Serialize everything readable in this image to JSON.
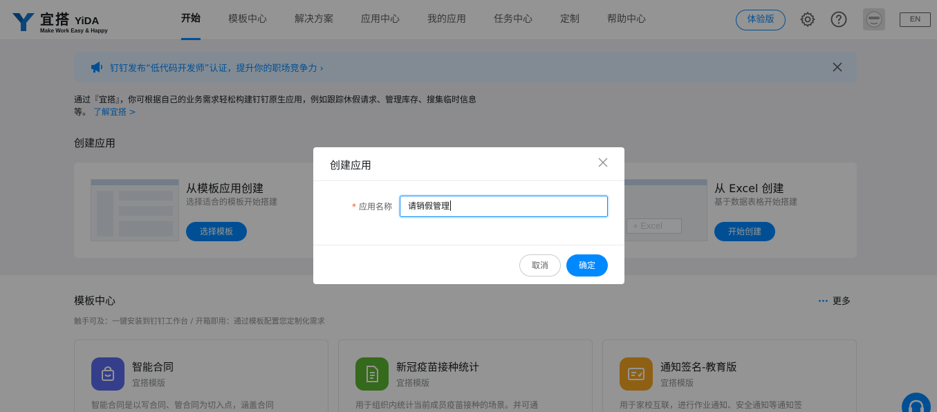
{
  "brand": {
    "name_cn": "宜搭",
    "name_en": "YiDA",
    "slogan": "Make Work Easy & Happy"
  },
  "nav": {
    "items": [
      {
        "label": "开始",
        "active": true
      },
      {
        "label": "模板中心"
      },
      {
        "label": "解决方案"
      },
      {
        "label": "应用中心"
      },
      {
        "label": "我的应用"
      },
      {
        "label": "任务中心"
      },
      {
        "label": "定制"
      },
      {
        "label": "帮助中心"
      }
    ],
    "trial_label": "体验版",
    "lang_label": "EN"
  },
  "banner": {
    "text": "钉钉发布“低代码开发师”认证，提升你的职场竞争力 ›"
  },
  "intro": {
    "text": "通过『宜搭』，你可根据自己的业务需求轻松构建钉钉原生应用，例如跟踪休假请求、管理库存、搜集临时信息等。",
    "link": "了解宜搭 >"
  },
  "create": {
    "section_title": "创建应用",
    "cards": [
      {
        "title": "从模板应用创建",
        "subtitle": "选择适合的模板开始搭建",
        "button": "选择模板"
      },
      {
        "title": "从 Excel 创建",
        "subtitle": "基于数据表格开始搭建",
        "button": "开始创建"
      }
    ]
  },
  "templates": {
    "section_title": "模板中心",
    "description": "触手可及：一键安装到钉钉工作台 / 开箱即用：通过模板配置您定制化需求",
    "more_label": "更多",
    "items": [
      {
        "name": "智能合同",
        "tag": "宜搭模版",
        "desc": "智能合同是以写合同、管合同为切入点，涵盖合同",
        "color": "#5b6cf0"
      },
      {
        "name": "新冠疫苗接种统计",
        "tag": "宜搭模版",
        "desc": "用于组织内统计当前成员疫苗接种的场景。并可通",
        "color": "#5cb531"
      },
      {
        "name": "通知签名-教育版",
        "tag": "宜搭模版",
        "desc": "用于家校互联，进行作业通知、安全通知等通知签",
        "color": "#f5a623"
      }
    ]
  },
  "modal": {
    "title": "创建应用",
    "field_label": "应用名称",
    "required_mark": "*",
    "input_value": "请销假管理",
    "cancel_label": "取消",
    "ok_label": "确定"
  }
}
